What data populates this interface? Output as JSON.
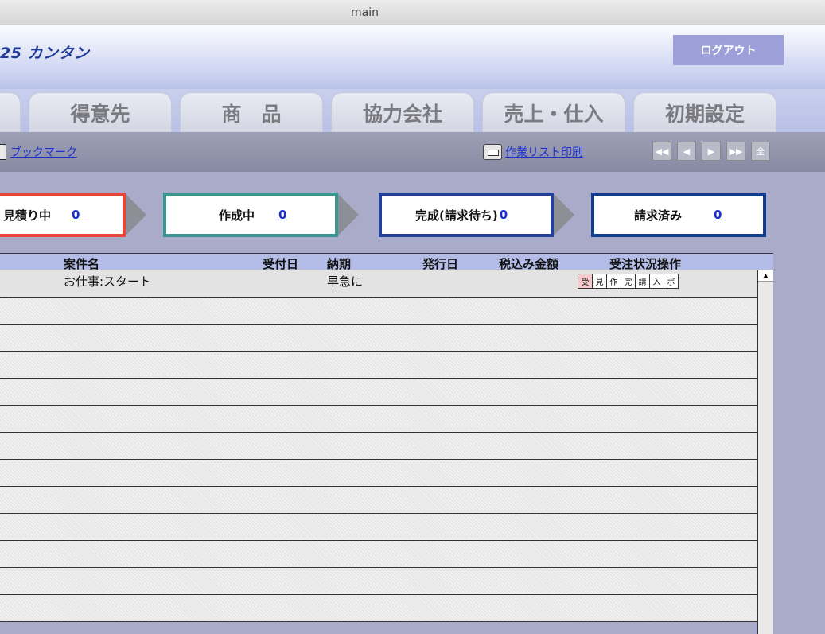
{
  "window": {
    "title": "main"
  },
  "header": {
    "app_title": "25 カンタン",
    "logout_label": "ログアウト"
  },
  "tabs": [
    {
      "label": ""
    },
    {
      "label": "得意先"
    },
    {
      "label": "商　品"
    },
    {
      "label": "協力会社"
    },
    {
      "label": "売上・仕入"
    },
    {
      "label": "初期設定"
    }
  ],
  "toolbar": {
    "bookmark_label": "ブックマーク",
    "print_label": "作業リスト印刷",
    "nav": [
      "◀◀",
      "◀",
      "▶",
      "▶▶",
      "全"
    ]
  },
  "status": [
    {
      "label": "見積り中",
      "count": "0",
      "color": "#e8463a"
    },
    {
      "label": "作成中",
      "count": "0",
      "color": "#3a9690"
    },
    {
      "label": "完成(請求待ち)",
      "count": "0",
      "color": "#23419b"
    },
    {
      "label": "請求済み",
      "count": "0",
      "color": "#123e92"
    }
  ],
  "table": {
    "headers": [
      "案件名",
      "受付日",
      "納期",
      "発行日",
      "税込み金額",
      "受注状況操作"
    ],
    "first_row": {
      "name": "お仕事:スタート",
      "deadline": "早急に"
    },
    "ops": [
      "受",
      "見",
      "作",
      "完",
      "請",
      "入",
      "ボ"
    ]
  }
}
